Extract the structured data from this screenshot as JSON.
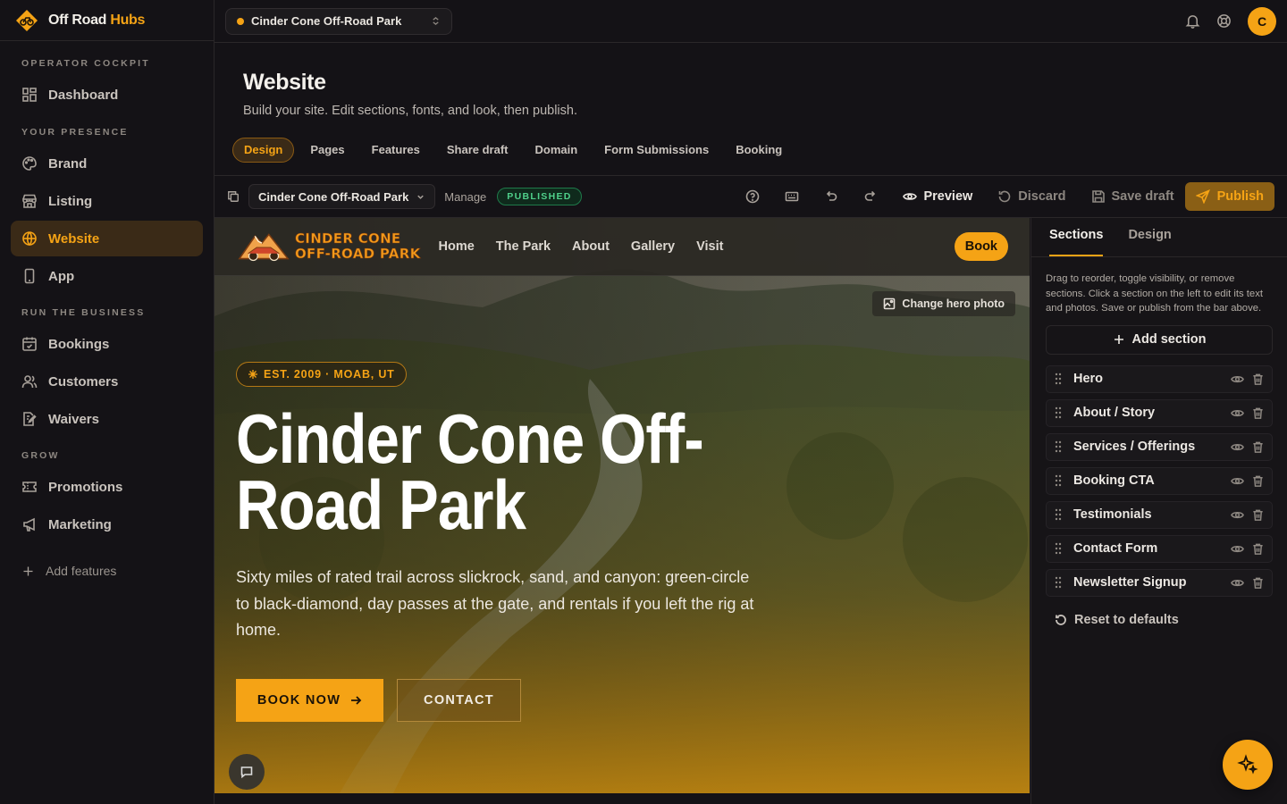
{
  "app": {
    "name_part1": "Off Road",
    "name_part2": "Hubs",
    "accent": "#f5a315"
  },
  "sidebar": {
    "sections": [
      {
        "heading": "OPERATOR COCKPIT",
        "items": [
          {
            "label": "Dashboard",
            "icon": "dashboard-icon"
          }
        ]
      },
      {
        "heading": "YOUR PRESENCE",
        "items": [
          {
            "label": "Brand",
            "icon": "palette-icon"
          },
          {
            "label": "Listing",
            "icon": "store-icon"
          },
          {
            "label": "Website",
            "icon": "globe-icon",
            "active": true
          },
          {
            "label": "App",
            "icon": "phone-icon"
          }
        ]
      },
      {
        "heading": "RUN THE BUSINESS",
        "items": [
          {
            "label": "Bookings",
            "icon": "calendar-icon"
          },
          {
            "label": "Customers",
            "icon": "users-icon"
          },
          {
            "label": "Waivers",
            "icon": "waiver-icon"
          }
        ]
      },
      {
        "heading": "GROW",
        "items": [
          {
            "label": "Promotions",
            "icon": "ticket-icon"
          },
          {
            "label": "Marketing",
            "icon": "megaphone-icon"
          }
        ]
      }
    ],
    "add_features": "Add features"
  },
  "topbar": {
    "site_name": "Cinder Cone Off-Road Park",
    "avatar_initial": "C"
  },
  "page": {
    "title": "Website",
    "subtitle": "Build your site. Edit sections, fonts, and look, then publish.",
    "tabs": [
      "Design",
      "Pages",
      "Features",
      "Share draft",
      "Domain",
      "Form Submissions",
      "Booking"
    ],
    "active_tab": "Design"
  },
  "toolbar": {
    "site_name": "Cinder Cone Off-Road Park",
    "manage": "Manage",
    "status": "PUBLISHED",
    "preview": "Preview",
    "discard": "Discard",
    "save_draft": "Save draft",
    "publish": "Publish"
  },
  "preview": {
    "logo_line1": "CINDER CONE",
    "logo_line2": "OFF-ROAD PARK",
    "nav_links": [
      "Home",
      "The Park",
      "About",
      "Gallery",
      "Visit"
    ],
    "book": "Book",
    "change_photo": "Change hero photo",
    "est": "EST. 2009 · MOAB, UT",
    "title": "Cinder Cone Off-Road Park",
    "description": "Sixty miles of rated trail across slickrock, sand, and canyon: green-circle to black-diamond, day passes at the gate, and rentals if you left the rig at home.",
    "book_now": "BOOK NOW",
    "contact": "CONTACT"
  },
  "panel": {
    "tabs": [
      "Sections",
      "Design"
    ],
    "active_tab": "Sections",
    "help": "Drag to reorder, toggle visibility, or remove sections. Click a section on the left to edit its text and photos. Save or publish from the bar above.",
    "add_section": "Add section",
    "sections": [
      "Hero",
      "About / Story",
      "Services / Offerings",
      "Booking CTA",
      "Testimonials",
      "Contact Form",
      "Newsletter Signup"
    ],
    "reset": "Reset to defaults"
  }
}
